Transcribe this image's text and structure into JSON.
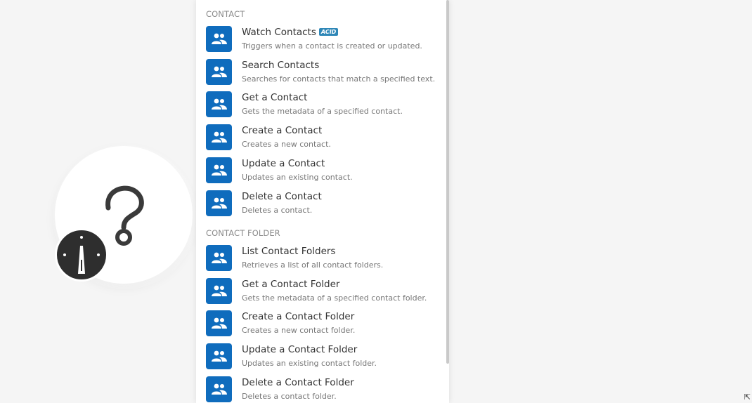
{
  "sections": [
    {
      "header": "Contact",
      "items": [
        {
          "title": "Watch Contacts",
          "badge": "ACID",
          "description": "Triggers when a contact is created or updated."
        },
        {
          "title": "Search Contacts",
          "description": "Searches for contacts that match a specified text."
        },
        {
          "title": "Get a Contact",
          "description": "Gets the metadata of a specified contact."
        },
        {
          "title": "Create a Contact",
          "description": "Creates a new contact."
        },
        {
          "title": "Update a Contact",
          "description": "Updates an existing contact."
        },
        {
          "title": "Delete a Contact",
          "description": "Deletes a contact."
        }
      ]
    },
    {
      "header": "Contact Folder",
      "items": [
        {
          "title": "List Contact Folders",
          "description": "Retrieves a list of all contact folders."
        },
        {
          "title": "Get a Contact Folder",
          "description": "Gets the metadata of a specified contact folder."
        },
        {
          "title": "Create a Contact Folder",
          "description": "Creates a new contact folder."
        },
        {
          "title": "Update a Contact Folder",
          "description": "Updates an existing contact folder."
        },
        {
          "title": "Delete a Contact Folder",
          "description": "Deletes a contact folder."
        }
      ]
    }
  ],
  "icons": {
    "item_icon": "contacts-icon",
    "module_icon": "question-mark-icon",
    "app_icon": "app-logo-icon"
  },
  "colors": {
    "tile": "#0f6cbd",
    "badge": "#2f87b7",
    "background": "#f5f5f5"
  }
}
